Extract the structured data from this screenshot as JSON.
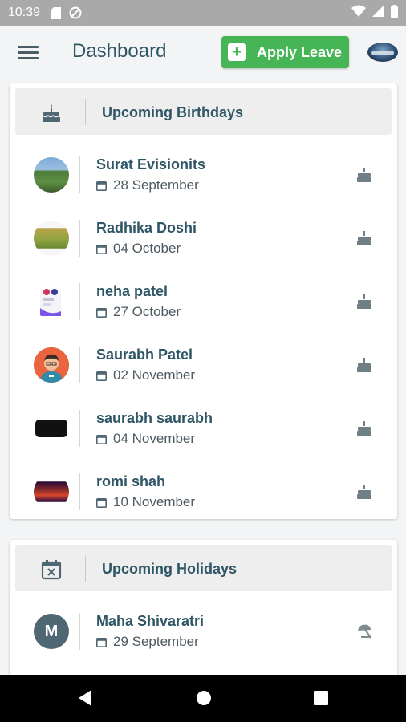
{
  "status_bar": {
    "time": "10:39"
  },
  "app_bar": {
    "title": "Dashboard",
    "apply_leave_label": "Apply Leave"
  },
  "birthdays": {
    "title": "Upcoming Birthdays",
    "items": [
      {
        "name": "Surat Evisionits",
        "date": "28 September"
      },
      {
        "name": "Radhika Doshi",
        "date": "04 October"
      },
      {
        "name": "neha patel",
        "date": "27 October"
      },
      {
        "name": "Saurabh Patel",
        "date": "02 November"
      },
      {
        "name": "saurabh saurabh",
        "date": "04 November"
      },
      {
        "name": "romi shah",
        "date": "10 November"
      }
    ]
  },
  "holidays": {
    "title": "Upcoming Holidays",
    "items": [
      {
        "initial": "M",
        "name": "Maha Shivaratri",
        "date": "29 September"
      }
    ]
  },
  "colors": {
    "accent_green": "#46b556",
    "text_teal": "#2f5666",
    "status_bar": "#a9a9a9"
  },
  "icons": {
    "menu": "menu-icon",
    "apply": "plus-icon",
    "birthday_header": "cake-icon",
    "birthday_trailing": "cake-icon",
    "holiday_header": "calendar-x-icon",
    "holiday_trailing": "beach-umbrella-icon",
    "date": "calendar-icon"
  }
}
